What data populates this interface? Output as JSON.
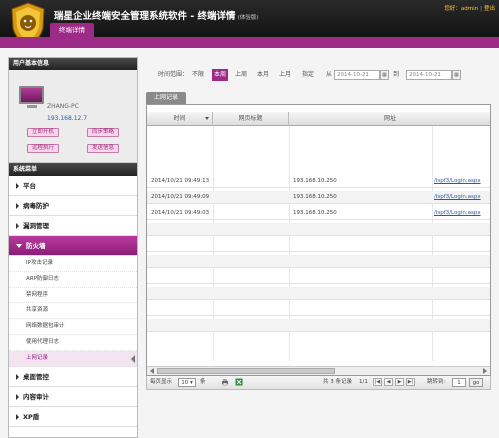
{
  "header": {
    "app_title": "瑞星企业终端安全管理系统软件 - 终端详情",
    "edition": "(体验版)",
    "greeting_prefix": "您好：",
    "user": "admin",
    "logout": "登出",
    "active_tab": "终端详情"
  },
  "sidebar": {
    "user_info_title": "用户基本信息",
    "pc_name": "ZHANG-PC",
    "pc_ip": "193.168.12.7",
    "buttons": [
      "立即开机",
      "同步策略",
      "远程执行",
      "发送信息"
    ],
    "system_title": "系统菜单",
    "menu": [
      {
        "label": "平台"
      },
      {
        "label": "病毒防护"
      },
      {
        "label": "漏洞管理"
      },
      {
        "label": "防火墙"
      }
    ],
    "submenu": [
      "IP攻击记录",
      "ARP防御日志",
      "禁网程序",
      "共享资源",
      "网络数据包审计",
      "使用代理日志",
      "上网记录"
    ],
    "menu_after": [
      {
        "label": "桌面管控"
      },
      {
        "label": "内容审计"
      },
      {
        "label": "XP盾"
      }
    ]
  },
  "filter": {
    "label": "时间范围：",
    "options": [
      "不限",
      "本周",
      "上周",
      "本月",
      "上月",
      "指定"
    ],
    "selected": "本周",
    "from_label": "从",
    "from_date": "2014-10-21",
    "to_label": "到",
    "to_date": "2014-10-21",
    "calendar_icon": "calendar-icon"
  },
  "table": {
    "tab_label": "上网记录",
    "columns": [
      "时间",
      "网页标题",
      "网址"
    ],
    "rows": [
      {
        "time": "2014/10/21 09:49:13",
        "title": "",
        "ip": "193.168.10.250",
        "url": "/lspf3/Login.aspx"
      },
      {
        "time": "2014/10/21 09:49:09",
        "title": "",
        "ip": "193.168.10.250",
        "url": "/lspf3/Login.aspx"
      },
      {
        "time": "2014/10/21 09:49:03",
        "title": "",
        "ip": "193.168.10.250",
        "url": "/lspf3/Login.aspx"
      }
    ]
  },
  "pager": {
    "per_page_label": "每页显示",
    "per_page_value": "10",
    "per_page_unit": "条",
    "total": "共 3 条记录",
    "page_info": "1/1",
    "jump_label": "跳转到:",
    "jump_value": "1",
    "go_label": "go",
    "first": "|◀",
    "prev": "◀",
    "next": "▶",
    "last": "▶|"
  },
  "colors": {
    "accent": "#9d2a86",
    "header_bg": "#111111",
    "link": "#2a58a8"
  }
}
